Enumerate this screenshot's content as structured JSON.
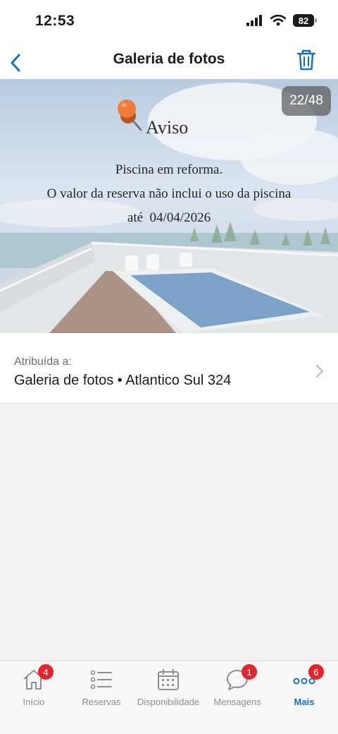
{
  "status_bar": {
    "time": "12:53",
    "battery": "82"
  },
  "nav": {
    "title": "Galeria de fotos"
  },
  "photo": {
    "counter": "22/48",
    "notice_title": "Aviso",
    "notice_lines": [
      "Piscina em reforma.",
      "O valor da reserva não inclui o uso da piscina",
      "até  04/04/2026"
    ]
  },
  "assigned": {
    "label": "Atribuída a:",
    "value": "Galeria de fotos • Atlantico Sul 324"
  },
  "tabs": [
    {
      "label": "Início",
      "badge": "4",
      "icon": "home-icon"
    },
    {
      "label": "Reservas",
      "icon": "list-icon"
    },
    {
      "label": "Disponibilidade",
      "icon": "calendar-icon"
    },
    {
      "label": "Mensagens",
      "badge": "1",
      "icon": "chat-bubble-icon"
    },
    {
      "label": "Mais",
      "badge": "6",
      "icon": "more-dots-icon",
      "active": true
    }
  ],
  "colors": {
    "accent": "#1a6fb8",
    "badge": "#e5252d",
    "pin": "#f07a3a"
  }
}
